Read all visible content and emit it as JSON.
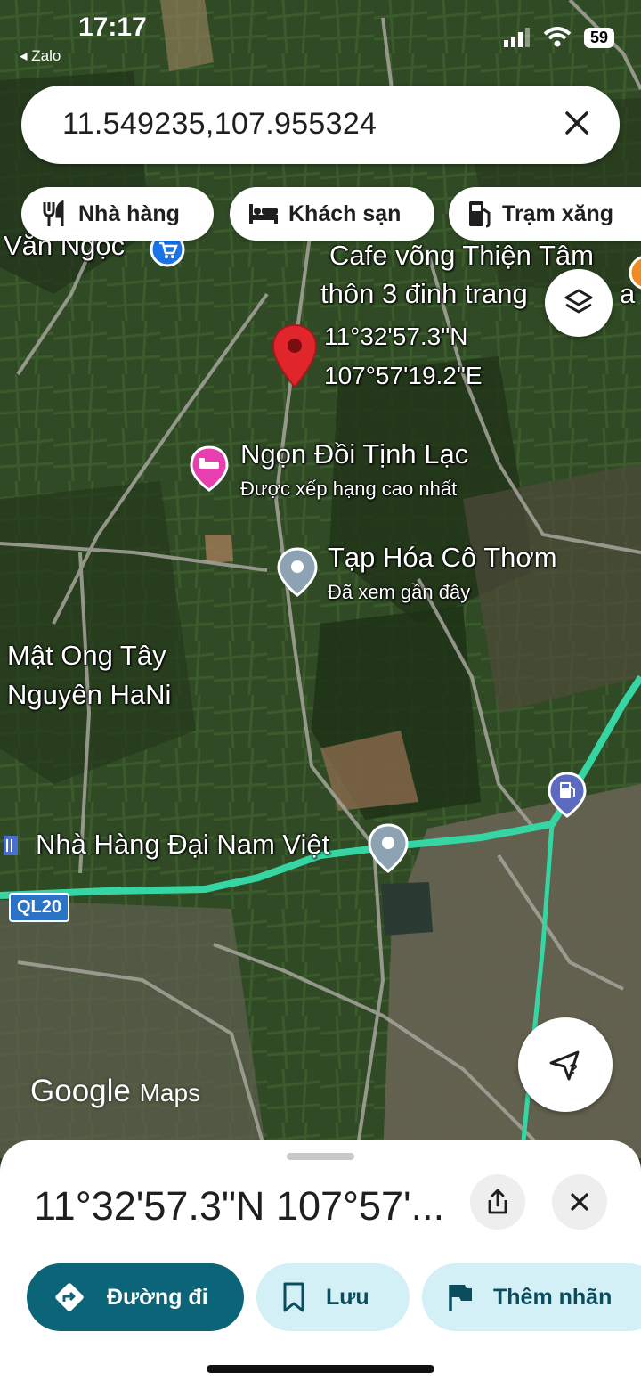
{
  "status_bar": {
    "time": "17:17",
    "back_app": "◂ Zalo",
    "battery": "59"
  },
  "search": {
    "value": "11.549235,107.955324"
  },
  "chips": [
    {
      "label": "Nhà hàng",
      "icon": "restaurant-icon"
    },
    {
      "label": "Khách sạn",
      "icon": "hotel-icon"
    },
    {
      "label": "Trạm xăng",
      "icon": "gas-station-icon"
    }
  ],
  "map": {
    "labels": {
      "van_ngoc": "Văn Ngọc",
      "cafe_line1": "Cafe võng Thiện Tâm",
      "cafe_line2": "thôn 3 đinh trang",
      "cafe_line2_tail": "a",
      "pin_lat": "11°32'57.3\"N",
      "pin_lng": "107°57'19.2\"E",
      "ngon_doi": "Ngọn Đồi Tịnh Lạc",
      "ngon_doi_sub": "Được xếp hạng cao nhất",
      "tap_hoa": "Tạp Hóa Cô Thơm",
      "tap_hoa_sub": "Đã xem gần đây",
      "mat_ong_1": "Mật Ong Tây",
      "mat_ong_2": "Nguyên HaNi",
      "nha_hang": "Nhà Hàng Đại Nam Việt",
      "road": "QL20"
    },
    "logo_google": "Google",
    "logo_maps": "Maps"
  },
  "sheet": {
    "coords": "11°32'57.3\"N 107°57'...",
    "actions": [
      {
        "label": "Đường đi",
        "icon": "directions-icon"
      },
      {
        "label": "Lưu",
        "icon": "bookmark-icon"
      },
      {
        "label": "Thêm nhãn",
        "icon": "flag-icon"
      }
    ]
  },
  "colors": {
    "route": "#35d6a3",
    "primary": "#0b6477",
    "chip_light": "#d3f0f7",
    "pin": "#e0262b"
  }
}
